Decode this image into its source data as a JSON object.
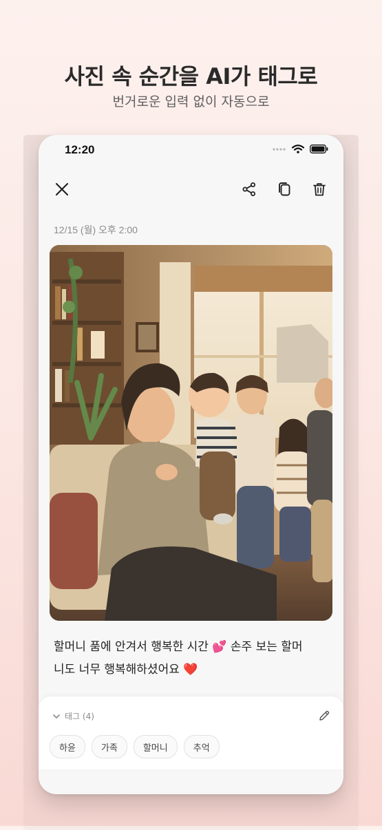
{
  "promo": {
    "headline": "사진 속 순간을 AI가 태그로",
    "subheadline": "번거로운 입력 없이 자동으로"
  },
  "status_bar": {
    "time": "12:20",
    "icons": [
      "signal-dots-icon",
      "wifi-icon",
      "battery-icon"
    ]
  },
  "toolbar": {
    "close_icon": "close-icon",
    "actions": [
      "share-icon",
      "copy-icon",
      "trash-icon"
    ]
  },
  "photo_detail": {
    "date": "12/15 (월) 오후 2:00",
    "photo_description": "family photo",
    "caption_line1": "할머니 품에 안겨서 행복한 시간 💕 손주 보는 할머",
    "caption_line2": "니도 너무 행복해하셨어요 ❤️"
  },
  "tags": {
    "header": "태그 (4)",
    "items": [
      "하윤",
      "가족",
      "할머니",
      "추억"
    ],
    "edit_icon": "pencil-icon"
  },
  "colors": {
    "background_top": "#fdf1ee",
    "background_bottom": "#f9d9d4",
    "card": "#f7f7f7",
    "heart": "#e0252a"
  }
}
